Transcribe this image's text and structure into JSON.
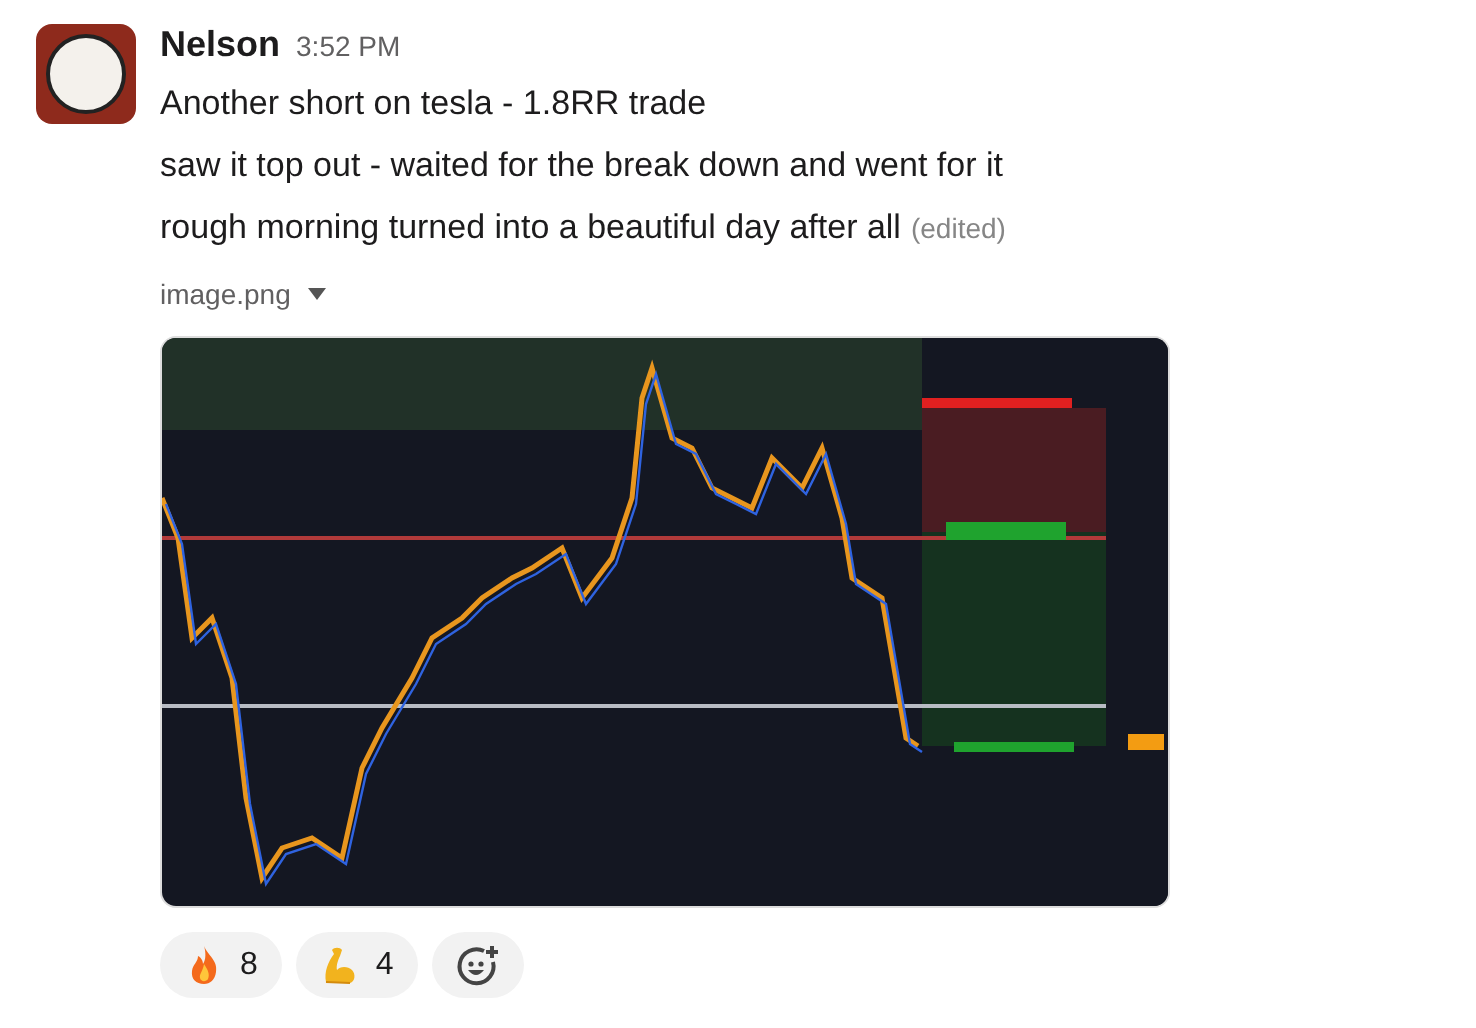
{
  "message": {
    "author": "Nelson",
    "time": "3:52 PM",
    "lines": [
      "Another short on tesla - 1.8RR trade",
      "saw it top out - waited for the break down and went for it",
      "rough morning turned into a beautiful day after all"
    ],
    "edited_label": "(edited)"
  },
  "attachment": {
    "filename": "image.png",
    "kind": "picture"
  },
  "reactions": [
    {
      "kind": "fire",
      "count": "8"
    },
    {
      "kind": "muscle",
      "count": "4"
    }
  ]
}
